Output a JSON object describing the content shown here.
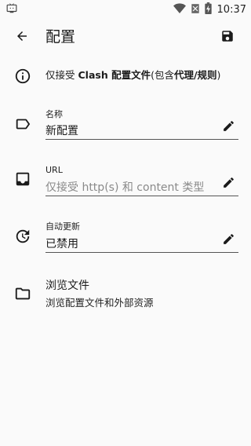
{
  "status_bar": {
    "time": "10:37",
    "icons": [
      "tv-icon",
      "wifi-icon",
      "no-sim-icon",
      "battery-charging-icon"
    ]
  },
  "app_bar": {
    "title": "配置",
    "back_icon": "arrow-back-icon",
    "save_icon": "save-icon"
  },
  "info": {
    "prefix": "仅接受 ",
    "bold1": "Clash 配置文件",
    "mid": "(包含",
    "bold2": "代理/规则",
    "suffix": ")"
  },
  "fields": {
    "name": {
      "label": "名称",
      "value": "新配置"
    },
    "url": {
      "label": "URL",
      "placeholder": "仅接受 http(s) 和 content 类型"
    },
    "auto_update": {
      "label": "自动更新",
      "value": "已禁用"
    }
  },
  "browse": {
    "title": "浏览文件",
    "subtitle": "浏览配置文件和外部资源"
  }
}
